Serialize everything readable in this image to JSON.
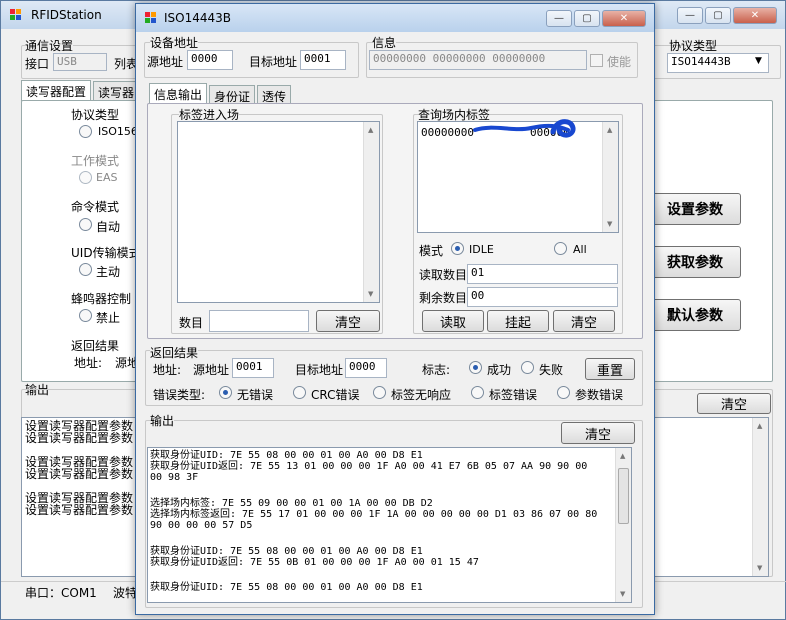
{
  "main": {
    "title": "RFIDStation",
    "comm_group": "通信设置",
    "port_label": "接口",
    "port_value": "USB",
    "list_partial": "列表",
    "tabs": [
      "读写器配置",
      "读写器"
    ],
    "proto_label": "协议类型",
    "proto_radio": "ISO156",
    "mode_label": "工作模式",
    "mode_radio": "EAS",
    "cmd_label": "命令模式",
    "cmd_radio": "自动",
    "uid_label": "UID传输模式",
    "uid_radio": "主动",
    "buzzer_label": "蜂鸣器控制",
    "buzzer_radio": "禁止",
    "return_label": "返回结果",
    "addr_label": "地址:",
    "src_partial": "源地",
    "proto_type_label": "协议类型",
    "proto_type_value": "ISO14443B",
    "btn_set": "设置参数",
    "btn_get": "获取参数",
    "btn_default": "默认参数",
    "output_label": "输出",
    "clear": "清空",
    "log": [
      "设置读写器配置参数",
      "设置读写器配置参数",
      "",
      "设置读写器配置参数",
      "设置读写器配置参数",
      "",
      "设置读写器配置参数",
      "设置读写器配置参数"
    ],
    "status_port": "串口：COM1",
    "status_baud": "波特"
  },
  "dlg": {
    "title": "ISO14443B",
    "dev_addr_group": "设备地址",
    "src_label": "源地址",
    "src_value": "0000",
    "dst_label": "目标地址",
    "dst_value": "0001",
    "info_group": "信息",
    "info_value": "00000000 00000000 00000000",
    "enable_label": "使能",
    "tabs": [
      "信息输出",
      "身份证",
      "透传"
    ],
    "tag_enter_label": "标签进入场",
    "count_label": "数目",
    "clear": "清空",
    "query_label": "查询场内标签",
    "query_item_a": "00000000",
    "query_item_b": "000000",
    "mode_label": "模式",
    "mode_idle": "IDLE",
    "mode_all": "All",
    "read_count_label": "读取数目",
    "read_count_value": "01",
    "remain_label": "剩余数目",
    "remain_value": "00",
    "btn_read": "读取",
    "btn_hang": "挂起",
    "result_group": "返回结果",
    "addr_label": "地址:",
    "res_src_label": "源地址",
    "res_src_value": "0001",
    "res_dst_label": "目标地址",
    "res_dst_value": "0000",
    "flag_label": "标志:",
    "flag_ok": "成功",
    "flag_fail": "失败",
    "btn_reset": "重置",
    "err_label": "错误类型:",
    "err_none": "无错误",
    "err_crc": "CRC错误",
    "err_noresp": "标签无响应",
    "err_tag": "标签错误",
    "err_param": "参数错误",
    "output_label": "输出",
    "log": [
      "获取身份证UID: 7E 55 08 00 00 01 00 A0 00 D8 E1",
      "获取身份证UID返回: 7E 55 13 01 00 00 00 1F A0 00 41 E7 6B 05 07 AA 90 90 00",
      "00 98 3F",
      "",
      "选择场内标签: 7E 55 09 00 00 01 00 1A 00 00 DB D2",
      "选择场内标签返回: 7E 55 17 01 00 00 00 1F 1A 00 00 00 00 00 D1 03 86 07 00 80",
      "90 00 00 00 57 D5",
      "",
      "获取身份证UID: 7E 55 08 00 00 01 00 A0 00 D8 E1",
      "获取身份证UID返回: 7E 55 0B 01 00 00 00 1F A0 00 01 15 47",
      "",
      "获取身份证UID: 7E 55 08 00 00 01 00 A0 00 D8 E1"
    ]
  },
  "colors": {
    "titlebar": "#c9daf0",
    "accent_radio": "#2a5db0",
    "scribble": "#1848d0"
  }
}
